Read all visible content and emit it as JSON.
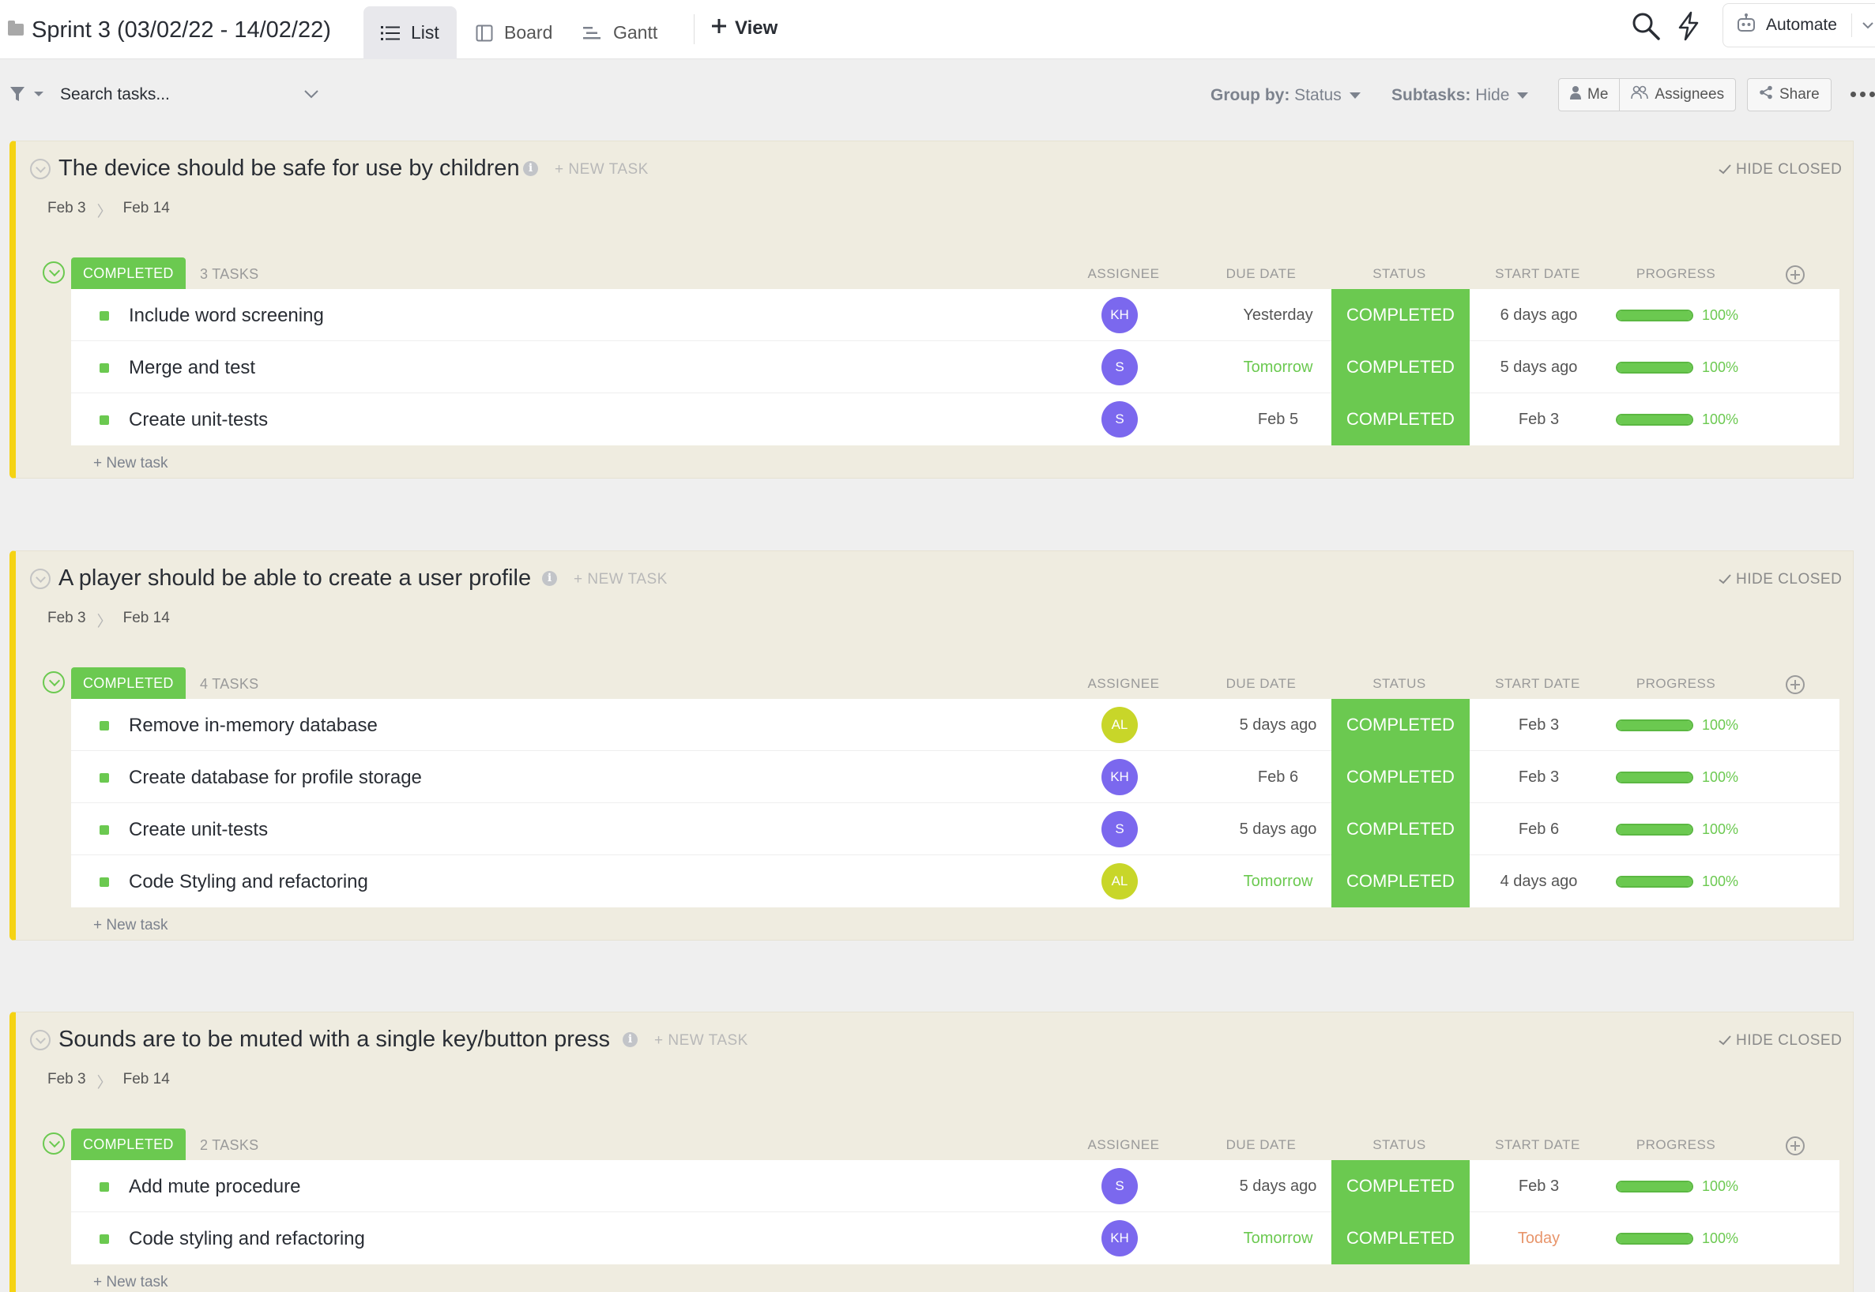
{
  "header": {
    "title": "Sprint 3 (03/02/22 - 14/02/22)",
    "tabs": [
      {
        "label": "List",
        "active": true,
        "icon": "list-icon"
      },
      {
        "label": "Board",
        "active": false,
        "icon": "board-icon"
      },
      {
        "label": "Gantt",
        "active": false,
        "icon": "gantt-icon"
      }
    ],
    "add_view_label": "View",
    "automate_label": "Automate"
  },
  "toolbar": {
    "search_placeholder": "Search tasks...",
    "group_by_label": "Group by:",
    "group_by_value": "Status",
    "subtasks_label": "Subtasks:",
    "subtasks_value": "Hide",
    "me_label": "Me",
    "assignees_label": "Assignees",
    "share_label": "Share"
  },
  "columns": {
    "assignee": "ASSIGNEE",
    "due_date": "DUE DATE",
    "status": "STATUS",
    "start_date": "START DATE",
    "progress": "PROGRESS"
  },
  "colors": {
    "completed_green": "#6bc950",
    "section_accent": "#f5d313",
    "section_bg": "#efece0",
    "avatar_purple": "#7b68ee",
    "avatar_lime": "#c8d629"
  },
  "sections": [
    {
      "title": "The device should be safe for use by children",
      "new_task_label": "+ NEW TASK",
      "hide_closed_label": "HIDE CLOSED",
      "date_start": "Feb 3",
      "date_end": "Feb 14",
      "group_status": "COMPLETED",
      "task_count": "3 TASKS",
      "add_task_label": "+ New task",
      "tasks": [
        {
          "name": "Include word screening",
          "assignee": "KH",
          "due": "Yesterday",
          "due_color": "normal",
          "status": "COMPLETED",
          "start": "6 days ago",
          "start_color": "normal",
          "progress": "100%",
          "progress_value": 1.0
        },
        {
          "name": "Merge and test",
          "assignee": "S",
          "due": "Tomorrow",
          "due_color": "green",
          "status": "COMPLETED",
          "start": "5 days ago",
          "start_color": "normal",
          "progress": "100%",
          "progress_value": 1.0
        },
        {
          "name": "Create unit-tests",
          "assignee": "S",
          "due": "Feb 5",
          "due_color": "normal",
          "status": "COMPLETED",
          "start": "Feb 3",
          "start_color": "normal",
          "progress": "100%",
          "progress_value": 1.0
        }
      ]
    },
    {
      "title": "A player should be able to create a user profile",
      "new_task_label": "+ NEW TASK",
      "hide_closed_label": "HIDE CLOSED",
      "date_start": "Feb 3",
      "date_end": "Feb 14",
      "group_status": "COMPLETED",
      "task_count": "4 TASKS",
      "add_task_label": "+ New task",
      "tasks": [
        {
          "name": "Remove in-memory database",
          "assignee": "AL",
          "due": "5 days ago",
          "due_color": "normal",
          "status": "COMPLETED",
          "start": "Feb 3",
          "start_color": "normal",
          "progress": "100%",
          "progress_value": 1.0
        },
        {
          "name": "Create database for profile storage",
          "assignee": "KH",
          "due": "Feb 6",
          "due_color": "normal",
          "status": "COMPLETED",
          "start": "Feb 3",
          "start_color": "normal",
          "progress": "100%",
          "progress_value": 1.0
        },
        {
          "name": "Create unit-tests",
          "assignee": "S",
          "due": "5 days ago",
          "due_color": "normal",
          "status": "COMPLETED",
          "start": "Feb 6",
          "start_color": "normal",
          "progress": "100%",
          "progress_value": 1.0
        },
        {
          "name": "Code Styling and refactoring",
          "assignee": "AL",
          "due": "Tomorrow",
          "due_color": "green",
          "status": "COMPLETED",
          "start": "4 days ago",
          "start_color": "normal",
          "progress": "100%",
          "progress_value": 1.0
        }
      ]
    },
    {
      "title": "Sounds are to be muted with a single key/button press",
      "new_task_label": "+ NEW TASK",
      "hide_closed_label": "HIDE CLOSED",
      "date_start": "Feb 3",
      "date_end": "Feb 14",
      "group_status": "COMPLETED",
      "task_count": "2 TASKS",
      "add_task_label": "+ New task",
      "tasks": [
        {
          "name": "Add mute procedure",
          "assignee": "S",
          "due": "5 days ago",
          "due_color": "normal",
          "status": "COMPLETED",
          "start": "Feb 3",
          "start_color": "normal",
          "progress": "100%",
          "progress_value": 1.0
        },
        {
          "name": "Code styling and refactoring",
          "assignee": "KH",
          "due": "Tomorrow",
          "due_color": "green",
          "status": "COMPLETED",
          "start": "Today",
          "start_color": "orange",
          "progress": "100%",
          "progress_value": 1.0
        }
      ]
    }
  ]
}
